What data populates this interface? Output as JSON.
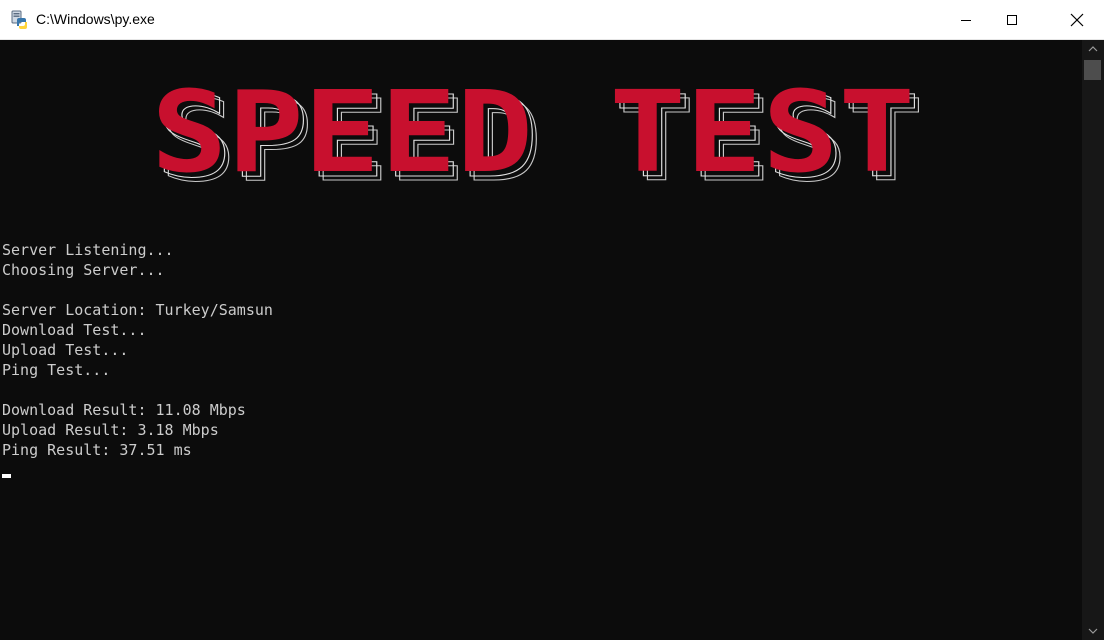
{
  "window": {
    "title": "C:\\Windows\\py.exe",
    "icon": "python-launcher-icon",
    "controls": [
      "minimize-icon",
      "maximize-icon",
      "close-icon"
    ]
  },
  "banner": {
    "text": "SPEED TEST",
    "color": "#c8102e"
  },
  "console": {
    "background": "#0c0c0c",
    "text_color": "#cccccc",
    "lines": [
      "Server Listening...",
      "Choosing Server...",
      "",
      "Server Location: Turkey/Samsun",
      "Download Test...",
      "Upload Test...",
      "Ping Test...",
      "",
      "Download Result: 11.08 Mbps",
      "Upload Result: 3.18 Mbps",
      "Ping Result: 37.51 ms"
    ]
  }
}
